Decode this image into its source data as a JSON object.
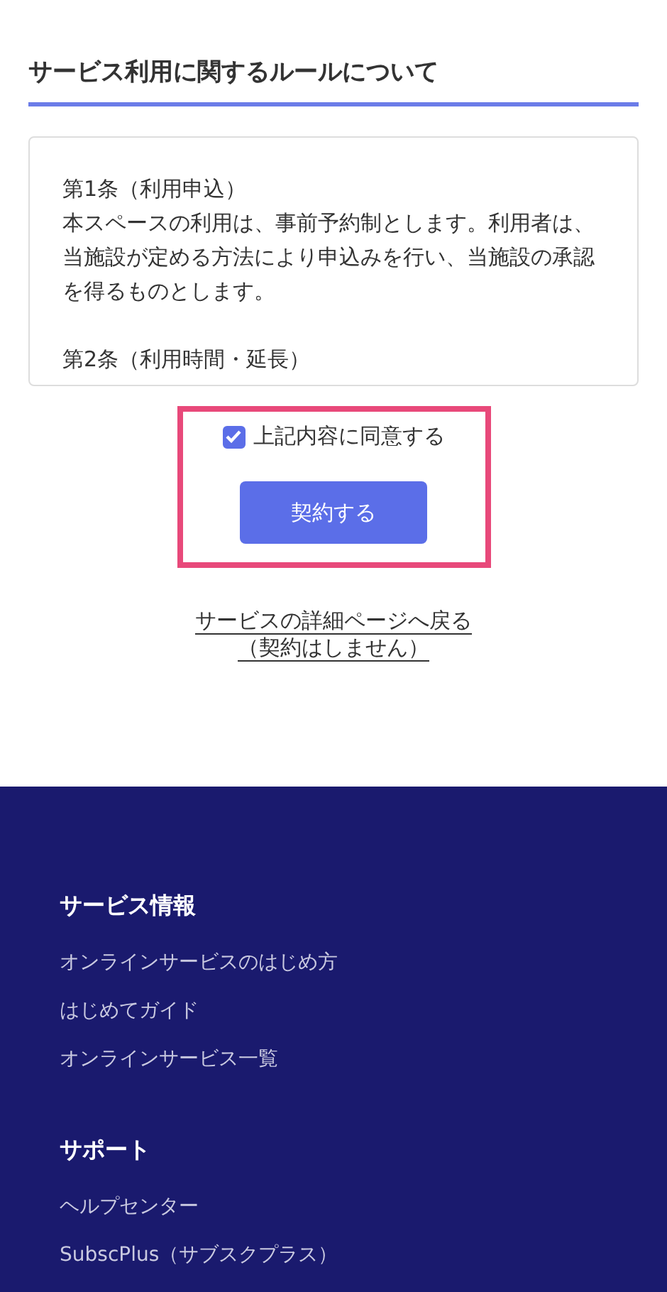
{
  "rules": {
    "title": "サービス利用に関するルールについて",
    "articles": [
      {
        "heading": "第1条（利用申込）",
        "body": "本スペースの利用は、事前予約制とします。利用者は、当施設が定める方法により申込みを行い、当施設の承認を得るものとします。"
      },
      {
        "heading": "第2条（利用時間・延長）"
      }
    ]
  },
  "agreement": {
    "label": "上記内容に同意する",
    "checked": true
  },
  "submit_button": "契約する",
  "back_link": {
    "line_1": "サービスの詳細ページへ戻る",
    "line_2": "（契約はしません）"
  },
  "footer": {
    "sections": [
      {
        "title": "サービス情報",
        "links": [
          "オンラインサービスのはじめ方",
          "はじめてガイド",
          "オンラインサービス一覧"
        ]
      },
      {
        "title": "サポート",
        "links": [
          "ヘルプセンター",
          "SubscPlus（サブスクプラス）"
        ]
      }
    ]
  }
}
